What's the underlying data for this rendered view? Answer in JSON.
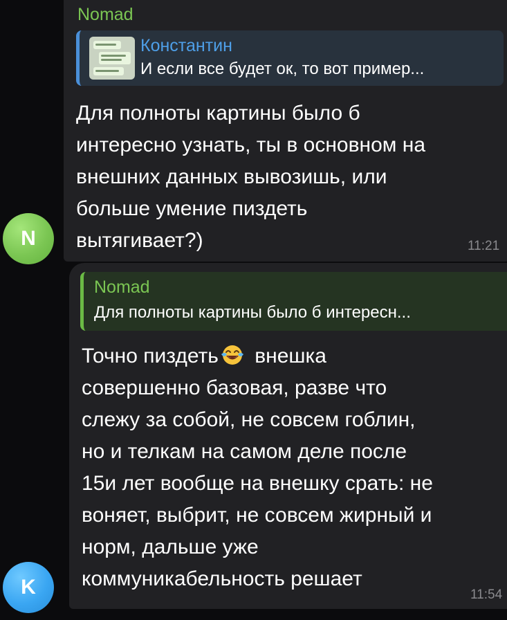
{
  "messages": [
    {
      "sender": "Nomad",
      "avatar_letter": "N",
      "reply": {
        "name": "Константин",
        "text": "И если все будет ок, то вот пример..."
      },
      "text": "Для полноты картины было б\nинтересно узнать, ты в основном на\nвнешних данных вывозишь, или\nбольше умение пиздеть\nвытягивает?)",
      "time": "11:21"
    },
    {
      "avatar_letter": "K",
      "reply": {
        "name": "Nomad",
        "text": "Для полноты картины было б интересн..."
      },
      "text_before_emoji": "Точно пиздеть",
      "emoji": "tears-of-joy-emoji",
      "text_after_emoji": " внешка\nсовершенно базовая, разве что\nслежу за собой, не совсем гоблин,\nно и телкам на самом деле после\n15и лет вообще на внешку срать: не\nвоняет, выбрит, не совсем жирный и\nнорм, дальше уже\nкоммуникабельность решает",
      "time": "11:54"
    }
  ],
  "colors": {
    "background": "#0b0b0d",
    "bubble": "#212124",
    "accent_green": "#7bc653",
    "accent_blue": "#4e9fe8"
  }
}
